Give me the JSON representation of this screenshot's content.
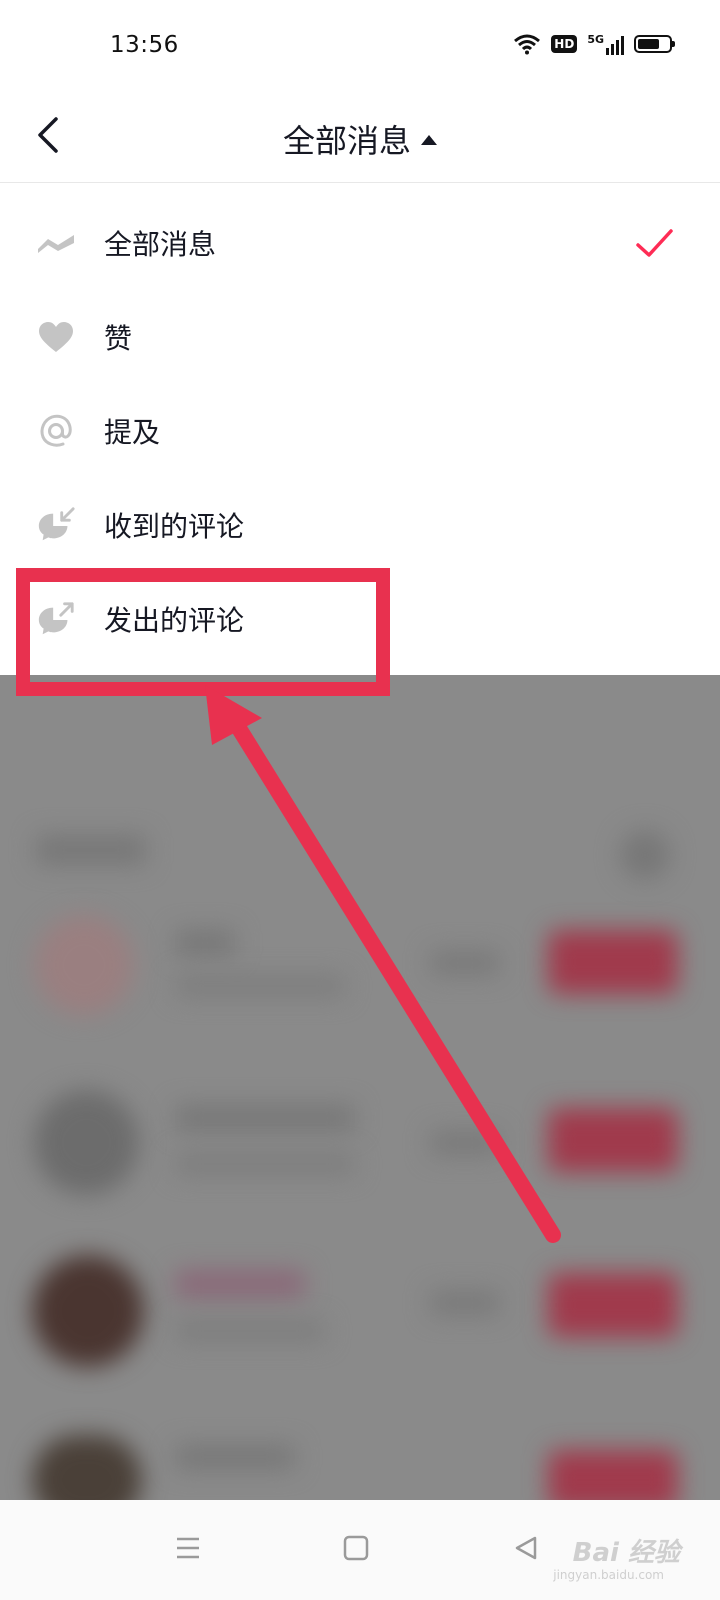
{
  "status_bar": {
    "time": "13:56",
    "hd_label": "HD",
    "network_label": "5G",
    "battery_level": 0.7
  },
  "header": {
    "title": "全部消息",
    "back_icon": "chevron-left-icon",
    "caret_icon": "caret-up-icon"
  },
  "menu": {
    "items": [
      {
        "label": "全部消息",
        "icon": "wave-icon",
        "selected": true
      },
      {
        "label": "赞",
        "icon": "heart-icon",
        "selected": false
      },
      {
        "label": "提及",
        "icon": "at-icon",
        "selected": false
      },
      {
        "label": "收到的评论",
        "icon": "comment-received-icon",
        "selected": false
      },
      {
        "label": "发出的评论",
        "icon": "comment-sent-icon",
        "selected": false
      }
    ]
  },
  "colors": {
    "accent": "#fe2c55",
    "annotation": "#e8314f",
    "icon_gray": "#c4c4c4",
    "overlay": "#8a8a8a"
  },
  "watermark": {
    "text": "Bai 经验",
    "sub": "jingyan.baidu.com"
  },
  "bottom_nav": {
    "icons": [
      "menu-icon",
      "home-icon",
      "back-triangle-icon"
    ]
  }
}
